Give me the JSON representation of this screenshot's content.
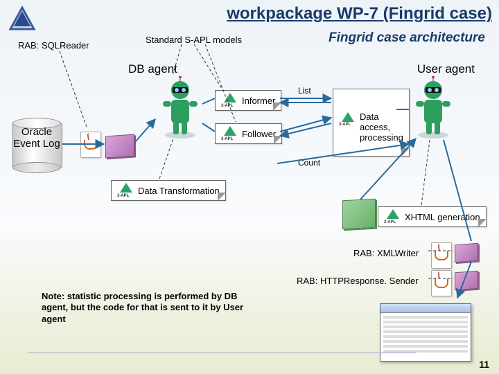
{
  "title": "workpackage WP-7 (Fingrid case)",
  "subtitle": "Fingrid case architecture",
  "labels": {
    "rab_sqlreader": "RAB: SQLReader",
    "std_models": "Standard S-APL models",
    "db_agent": "DB agent",
    "user_agent": "User agent",
    "oracle": "Oracle\nEvent Log",
    "informer": "Informer",
    "follower": "Follower",
    "list": "List",
    "count": "Count",
    "data_access": "Data\naccess,\nprocessing",
    "data_transform": "Data Transformation",
    "xhtml_gen": "XHTML generation",
    "rab_xmlwriter": "RAB: XMLWriter",
    "rab_httpresp": "RAB: HTTPResponse. Sender"
  },
  "note": "Note: statistic processing is performed by DB agent, but the code for that is sent to it by User agent",
  "page": "11"
}
